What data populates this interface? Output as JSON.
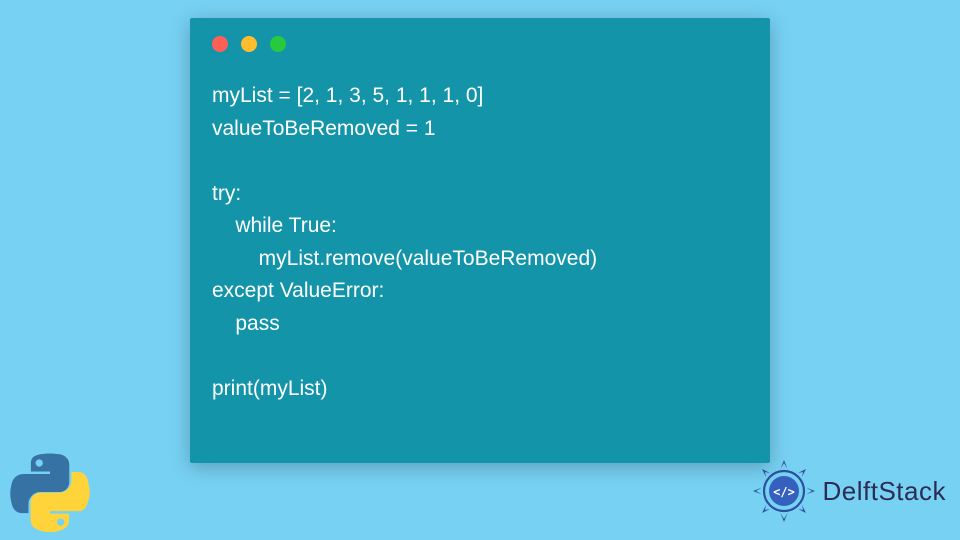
{
  "code": {
    "lines": [
      "myList = [2, 1, 3, 5, 1, 1, 1, 0]",
      "valueToBeRemoved = 1",
      "",
      "try:",
      "    while True:",
      "        myList.remove(valueToBeRemoved)",
      "except ValueError:",
      "    pass",
      "",
      "print(myList)"
    ]
  },
  "brand": {
    "name": "DelftStack"
  },
  "window": {
    "dot_colors": {
      "red": "#ff5f56",
      "yellow": "#ffbd2e",
      "green": "#27c93f"
    }
  },
  "language_icon": "python"
}
